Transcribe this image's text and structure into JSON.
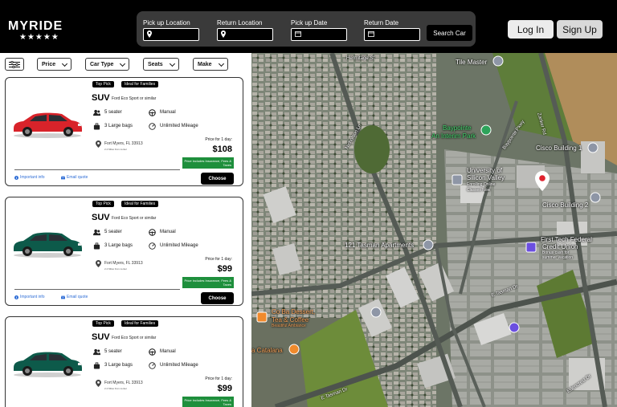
{
  "brand": {
    "logo": "MYRIDE",
    "stars": "★★★★★"
  },
  "search": {
    "pickup_location_label": "Pick up Location",
    "return_location_label": "Return Location",
    "pickup_date_label": "Pick up Date",
    "return_date_label": "Return Date",
    "search_button": "Search Car"
  },
  "auth": {
    "login": "Log In",
    "signup": "Sign Up"
  },
  "filters": {
    "price": "Price",
    "car_type": "Car Type",
    "seats": "Seats",
    "make": "Make"
  },
  "cards": [
    {
      "badges": [
        "Top Pick",
        "Ideal for Families"
      ],
      "type": "SUV",
      "model": "Ford Eco Sport or similar",
      "seats": "5 seater",
      "transmission": "Manual",
      "bags": "3 Large bags",
      "mileage": "Unlimited Mileage",
      "location": "Fort Myers, FL 33913",
      "distance": "2.4 Miles from center",
      "price_label": "Price for 1 day:",
      "price": "$108",
      "price_note": "Price includes Insurance, Fees & Taxes",
      "important_info": "Important info",
      "email_quote": "Email quote",
      "choose": "Choose",
      "car_color": "#d8232a"
    },
    {
      "badges": [
        "Top Pick",
        "Ideal for Families"
      ],
      "type": "SUV",
      "model": "Ford Eco Sport or similar",
      "seats": "5 seater",
      "transmission": "Manual",
      "bags": "3 Large bags",
      "mileage": "Unlimited Mileage",
      "location": "Fort Myers, FL 33913",
      "distance": "2.4 Miles from center",
      "price_label": "Price for 1 day:",
      "price": "$99",
      "price_note": "Price includes Insurance, Fees & Taxes",
      "important_info": "Important info",
      "email_quote": "Email quote",
      "choose": "Choose",
      "car_color": "#0d5a4a"
    },
    {
      "badges": [
        "Top Pick",
        "Ideal for Families"
      ],
      "type": "SUV",
      "model": "Ford Eco Sport or similar",
      "seats": "5 seater",
      "transmission": "Manual",
      "bags": "3 Large bags",
      "mileage": "Unlimited Mileage",
      "location": "Fort Myers, FL 33913",
      "distance": "2.4 Miles from center",
      "price_label": "Price for 1 day:",
      "price": "$99",
      "price_note": "Price includes Insurance, Fees & Taxes",
      "important_info": "",
      "email_quote": "",
      "choose": "",
      "car_color": "#0d5a4a"
    }
  ],
  "map": {
    "hermitage": "Hermitage St",
    "tile_master": "Tile Master",
    "zanker_rd": "Zanker Rd",
    "baypointe_park": "Baypointe",
    "baypointe_park2": "An Interim Park",
    "baypointe_pkwy": "Baypointe Pkwy",
    "cisco1": "Cisco Building 1",
    "cisco2": "Cisco Building 2",
    "usv1": "University of",
    "usv2": "Silicon Valley",
    "usv3": "Enrolling Online",
    "usv4": "Classes Now",
    "tasman_apts": "121 Tasman Apartments",
    "first_tech1": "First Tech Federal",
    "first_tech2": "Credit Union",
    "first_tech3": "Bonus cash for",
    "first_tech4": "summer vacation",
    "e_tasman": "E Tasman Dr",
    "coba1": "Co Ba Dessert,",
    "coba2": "Tea & Coffee",
    "coba3": "Beautiful Ambiance",
    "catalana": "a Catalana",
    "nicholson_ln": "Nicholson Ln",
    "edencrest": "Edencrest Dr"
  }
}
